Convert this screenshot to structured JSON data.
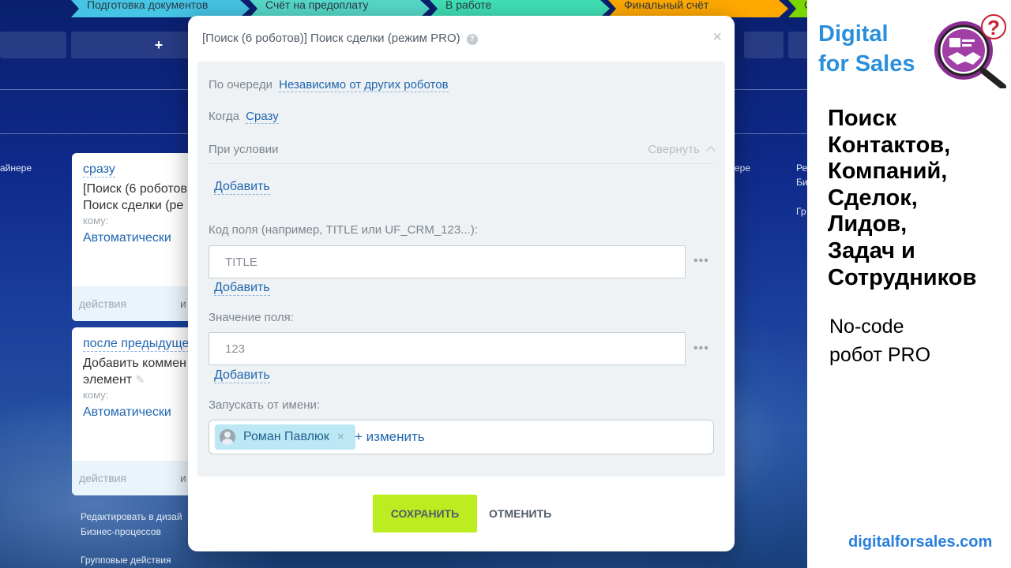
{
  "stages": [
    {
      "label": "Подготовка документов",
      "color": "#45c4e4"
    },
    {
      "label": "Счёт на предоплату",
      "color": "#56d9c9"
    },
    {
      "label": "В работе",
      "color": "#3fe0b6"
    },
    {
      "label": "Финальный счёт",
      "color": "#ffa900"
    },
    {
      "label": "С",
      "color": "#7bd500"
    }
  ],
  "board": {
    "add_stage": "+",
    "side_left": "айнере",
    "side_right_1": "ере",
    "side_right_2": "Ре",
    "side_right_3": "Би",
    "side_right_4": "Гр",
    "footer_link_1": "Редактировать в дизай",
    "footer_link_2": "Бизнес-процессов",
    "footer_link_3": "Групповые действия"
  },
  "cards": [
    {
      "when": "сразу",
      "title_line1": "[Поиск (6 роботов",
      "title_line2": "Поиск сделки (ре",
      "to": "кому:",
      "auto": "Автоматически",
      "actions": "действия",
      "actions_right": "и"
    },
    {
      "when": "после предыдуще",
      "title_line1": "Добавить коммен",
      "title_line2": "элемент",
      "to": "кому:",
      "auto": "Автоматически",
      "actions": "действия",
      "actions_right": "и"
    }
  ],
  "modal": {
    "title": "[Поиск (6 роботов)] Поиск сделки (режим PRO)",
    "help": "?",
    "close": "×",
    "queue_label": "По очереди",
    "queue_value": "Независимо от других роботов",
    "when_label": "Когда",
    "when_value": "Сразу",
    "condition_label": "При условии",
    "collapse_label": "Свернуть",
    "add_condition": "Добавить",
    "field_code_label": "Код поля (например, TITLE или UF_CRM_123...):",
    "field_code_value": "TITLE",
    "add_field_code": "Добавить",
    "field_value_label": "Значение поля:",
    "field_value_value": "123",
    "add_field_value": "Добавить",
    "dots": "•••",
    "run_as_label": "Запускать от имени:",
    "user_name": "Роман Павлюк",
    "remove_user": "×",
    "change_user": "+ изменить",
    "save": "СОХРАНИТЬ",
    "cancel": "ОТМЕНИТЬ"
  },
  "banner": {
    "brand_line1": "Digital",
    "brand_line2": "for Sales",
    "headline": [
      "Поиск",
      "Контактов,",
      "Компаний,",
      "Сделок,",
      "Лидов,",
      "Задач и",
      "Сотрудников"
    ],
    "sub_line1": "No-code",
    "sub_line2": "робот PRO",
    "site": "digitalforsales.com"
  }
}
